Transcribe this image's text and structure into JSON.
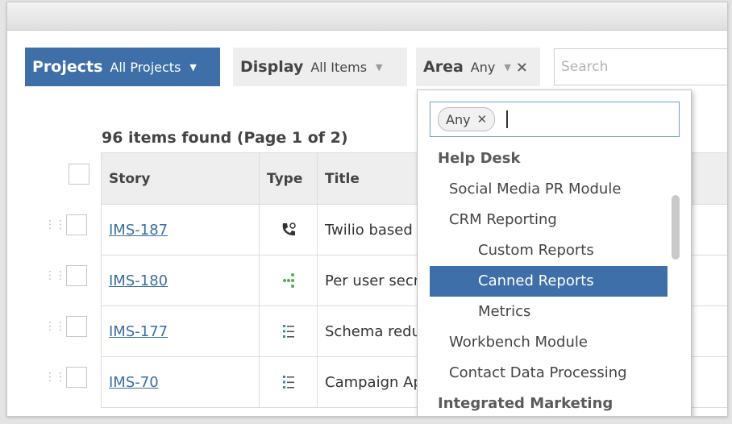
{
  "filters": {
    "projects": {
      "label": "Projects",
      "value": "All Projects"
    },
    "display": {
      "label": "Display",
      "value": "All Items"
    },
    "area": {
      "label": "Area",
      "value": "Any"
    },
    "search": {
      "placeholder": "Search"
    }
  },
  "results": {
    "count_text": "96 items found (Page 1 of 2)",
    "columns": {
      "story": "Story",
      "type": "Type",
      "title": "Title"
    },
    "rows": [
      {
        "story": "IMS-187",
        "type_icon": "phone-call-icon",
        "title": "Twilio based c"
      },
      {
        "story": "IMS-180",
        "type_icon": "dot-network-icon",
        "title": "Per user secre"
      },
      {
        "story": "IMS-177",
        "type_icon": "list-icon",
        "title": "Schema redun"
      },
      {
        "story": "IMS-70",
        "type_icon": "list-icon",
        "title": "Campaign App"
      }
    ]
  },
  "area_dropdown": {
    "chip": "Any",
    "options": [
      {
        "label": "Help Desk",
        "kind": "group"
      },
      {
        "label": "Social Media PR Module",
        "kind": "item"
      },
      {
        "label": "CRM Reporting",
        "kind": "item"
      },
      {
        "label": "Custom Reports",
        "kind": "subitem"
      },
      {
        "label": "Canned Reports",
        "kind": "subitem",
        "selected": true
      },
      {
        "label": "Metrics",
        "kind": "subitem"
      },
      {
        "label": "Workbench Module",
        "kind": "item"
      },
      {
        "label": "Contact Data Processing",
        "kind": "item"
      },
      {
        "label": "Integrated Marketing",
        "kind": "group"
      }
    ]
  },
  "colors": {
    "accent": "#3e6fa8",
    "link": "#3a6ea5",
    "icon_green": "#4caf50",
    "icon_teal": "#2f8f9d"
  }
}
